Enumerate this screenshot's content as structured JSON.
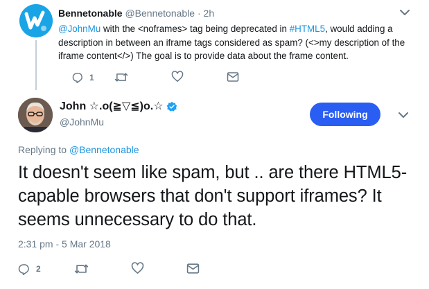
{
  "parent_tweet": {
    "name": "Bennetonable",
    "handle": "@Bennetonable",
    "separator": "·",
    "time": "2h",
    "text_parts": {
      "mention": "@JohnMu",
      "part1": " with the <noframes> tag being deprecated in ",
      "hashtag": "#HTML5",
      "part2": ", would adding a description in between an iframe tags considered as spam? (<>my description of the iframe content</>) The goal is to provide data about the frame content."
    },
    "reply_count": "1",
    "avatar_label": "w"
  },
  "main_tweet": {
    "name": "John ☆.o(≧▽≦)o.☆",
    "handle": "@JohnMu",
    "follow_label": "Following",
    "replying_prefix": "Replying to ",
    "replying_to": "@Bennetonable",
    "text": "It doesn't seem like spam, but .. are there HTML5-capable browsers that don't support iframes? It seems unnecessary to do that.",
    "timestamp": "2:31 pm - 5 Mar 2018",
    "reply_count": "2"
  },
  "colors": {
    "accent": "#1b95e0",
    "follow_button": "#2a5df2",
    "muted": "#657786",
    "verified": "#1da1f2"
  },
  "icons": [
    "reply-icon",
    "retweet-icon",
    "like-icon",
    "dm-icon",
    "chevron-down-icon",
    "verified-badge-icon"
  ]
}
